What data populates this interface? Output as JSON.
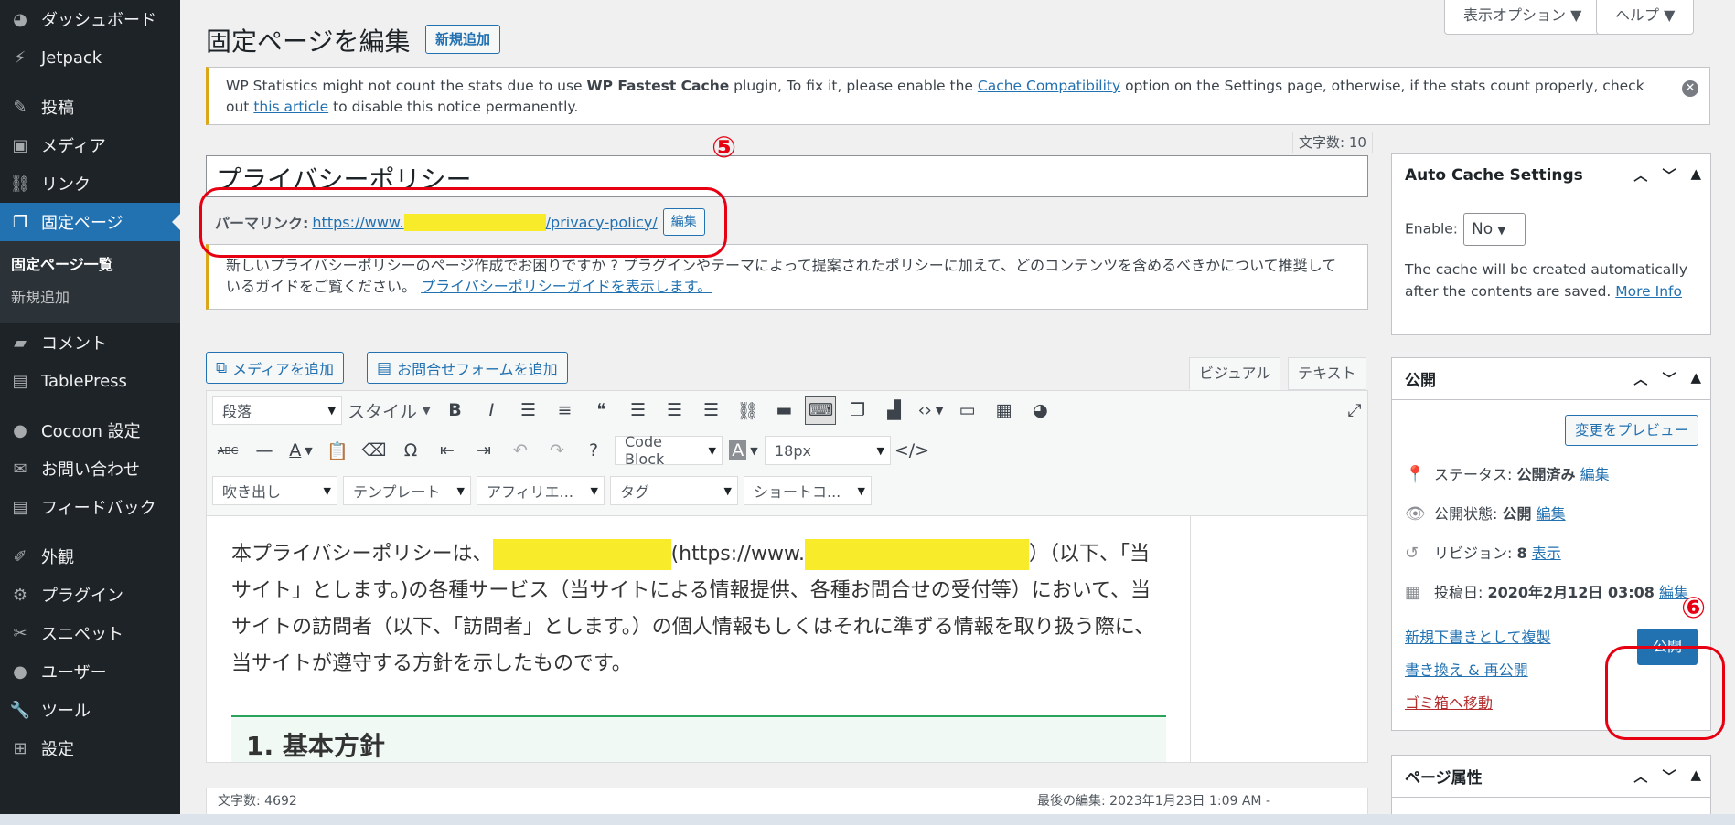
{
  "sidebar": {
    "items": [
      {
        "label": "ダッシュボード",
        "icon": "dashboard-icon",
        "glyph": "◕"
      },
      {
        "label": "Jetpack",
        "icon": "jetpack-icon",
        "glyph": "⚡"
      },
      {
        "label": "投稿",
        "icon": "pin-icon",
        "glyph": "📌"
      },
      {
        "label": "メディア",
        "icon": "media-icon",
        "glyph": "🖼"
      },
      {
        "label": "リンク",
        "icon": "link-icon",
        "glyph": "🔗"
      },
      {
        "label": "固定ページ",
        "icon": "page-icon",
        "glyph": "📄"
      },
      {
        "label": "コメント",
        "icon": "comment-icon",
        "glyph": "💬"
      },
      {
        "label": "TablePress",
        "icon": "table-icon",
        "glyph": "▤"
      },
      {
        "label": "Cocoon 設定",
        "icon": "circle-icon",
        "glyph": "●"
      },
      {
        "label": "お問い合わせ",
        "icon": "mail-icon",
        "glyph": "✉"
      },
      {
        "label": "フィードバック",
        "icon": "feedback-icon",
        "glyph": "▤"
      },
      {
        "label": "外観",
        "icon": "brush-icon",
        "glyph": "🖌"
      },
      {
        "label": "プラグイン",
        "icon": "plugin-icon",
        "glyph": "🔌"
      },
      {
        "label": "スニペット",
        "icon": "scissors-icon",
        "glyph": "✂"
      },
      {
        "label": "ユーザー",
        "icon": "user-icon",
        "glyph": "👤"
      },
      {
        "label": "ツール",
        "icon": "wrench-icon",
        "glyph": "🔧"
      },
      {
        "label": "設定",
        "icon": "settings-icon",
        "glyph": "⊞"
      }
    ],
    "submenu": {
      "list": "固定ページ一覧",
      "add": "新規追加"
    }
  },
  "header": {
    "title": "固定ページを編集",
    "add_new": "新規追加",
    "screen_options": "表示オプション ▼",
    "help": "ヘルプ ▼"
  },
  "notice": {
    "pre": "WP Statistics might not count the stats due to use ",
    "bold": "WP Fastest Cache",
    "mid1": " plugin, To fix it, please enable the ",
    "link1": "Cache Compatibility",
    "mid2": " option on the Settings page, otherwise, if the stats count properly, check out ",
    "link2": "this article",
    "post": " to disable this notice permanently."
  },
  "title_area": {
    "word_count": "文字数: 10",
    "title": "プライバシーポリシー",
    "permalink_label": "パーマリンク:",
    "permalink_prefix": "https://www.",
    "permalink_suffix": "/privacy-policy/",
    "permalink_edit": "編集"
  },
  "policy_notice": {
    "text": "新しいプライバシーポリシーのページ作成でお困りですか ? プラグインやテーマによって提案されたポリシーに加えて、どのコンテンツを含めるべきかについて推奨しているガイドをご覧ください。",
    "link": "プライバシーポリシーガイドを表示します。"
  },
  "editor": {
    "add_media": "メディアを追加",
    "add_form": "お問合せフォームを追加",
    "tab_visual": "ビジュアル",
    "tab_text": "テキスト",
    "toolbar": {
      "paragraph": "段落",
      "style": "スタイル",
      "code_block": "Code Block",
      "font_size": "18px",
      "balloon": "吹き出し",
      "template": "テンプレート",
      "affiliate": "アフィリエ...",
      "tag": "タグ",
      "shortcode": "ショートコ..."
    },
    "content": {
      "p1_start": "本プライバシーポリシーは、",
      "p1_mid": "(https://www.",
      "p1_rest": "）（以下、「当サイト」とします。)の各種サービス（当サイトによる情報提供、各種お問合せの受付等）において、当サイトの訪問者（以下、「訪問者」とします。）の個人情報もしくはそれに準ずる情報を取り扱う際に、当サイトが遵守する方針を示したものです。",
      "heading": "1.  基本方針"
    },
    "status": {
      "word_count": "文字数: 4692",
      "last_edit": "最後の編集: 2023年1月23日 1:09 AM -"
    }
  },
  "auto_cache": {
    "title": "Auto Cache Settings",
    "enable_label": "Enable:",
    "enable_value": "No",
    "desc": "The cache will be created automatically after the contents are saved.",
    "more_info": "More Info"
  },
  "publish": {
    "title": "公開",
    "preview": "変更をプレビュー",
    "status_label": "ステータス:",
    "status_value": "公開済み",
    "visibility_label": "公開状態:",
    "visibility_value": "公開",
    "revisions_label": "リビジョン:",
    "revisions_value": "8",
    "revisions_link": "表示",
    "date_label": "投稿日:",
    "date_value": "2020年2月12日 03:08",
    "edit": "編集",
    "duplicate": "新規下書きとして複製",
    "rewrite": "書き換え & 再公開",
    "trash": "ゴミ箱へ移動",
    "publish_btn": "公開"
  },
  "page_attributes": {
    "title": "ページ属性"
  },
  "annotations": {
    "five": "⑤",
    "six": "⑥"
  },
  "colors": {
    "accent": "#2271b1",
    "sidebar": "#1d2327",
    "annotation": "#e60012",
    "highlight": "#f8ec2a"
  }
}
